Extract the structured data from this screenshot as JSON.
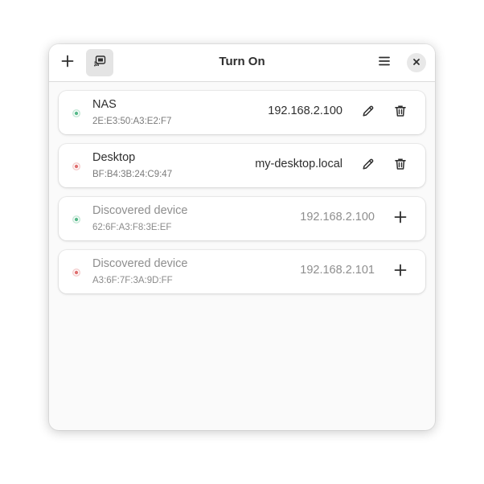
{
  "window": {
    "title": "Turn On"
  },
  "colors": {
    "online": "#57b98a",
    "offline": "#e07070",
    "icon": "#2e2e2e"
  },
  "headerbar": {
    "add_icon": "plus-icon",
    "discover_icon": "cast-icon",
    "menu_icon": "hamburger-menu-icon",
    "close_icon": "close-icon"
  },
  "devices": [
    {
      "name": "NAS",
      "mac": "2E:E3:50:A3:E2:F7",
      "address": "192.168.2.100",
      "status": "online",
      "discovered": false
    },
    {
      "name": "Desktop",
      "mac": "BF:B4:3B:24:C9:47",
      "address": "my-desktop.local",
      "status": "offline",
      "discovered": false
    },
    {
      "name": "Discovered device",
      "mac": "62:6F:A3:F8:3E:EF",
      "address": "192.168.2.100",
      "status": "online",
      "discovered": true
    },
    {
      "name": "Discovered device",
      "mac": "A3:6F:7F:3A:9D:FF",
      "address": "192.168.2.101",
      "status": "offline",
      "discovered": true
    }
  ]
}
